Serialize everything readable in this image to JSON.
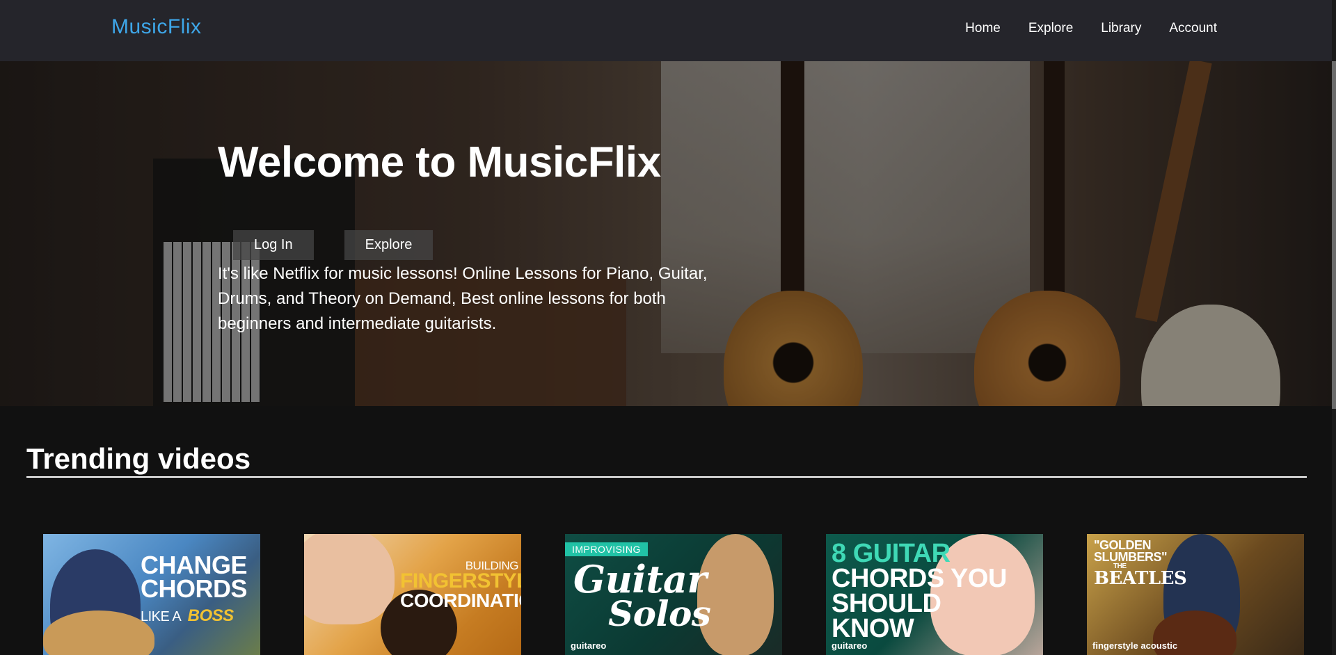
{
  "brand": "MusicFlix",
  "nav": {
    "items": [
      "Home",
      "Explore",
      "Library",
      "Account"
    ]
  },
  "hero": {
    "title": "Welcome to MusicFlix",
    "buttons": {
      "login": "Log In",
      "explore": "Explore"
    },
    "description": "It's like Netflix for music lessons! Online Lessons for Piano, Guitar, Drums, and Theory on Demand, Best online lessons for both beginners and intermediate guitarists."
  },
  "trending": {
    "title": "Trending videos",
    "videos": [
      {
        "line1": "CHANGE",
        "line2": "CHORDS",
        "line3": "LIKE A",
        "line4": "BOSS"
      },
      {
        "line1": "BUILDING",
        "line2": "FINGERSTYLE",
        "line3": "COORDINATION"
      },
      {
        "tag": "IMPROVISING",
        "line1": "Guitar",
        "line2": "Solos",
        "footer": "guitareo"
      },
      {
        "line1": "8 GUITAR",
        "line2": "CHORDS YOU",
        "line3": "SHOULD",
        "line4": "KNOW",
        "footer": "guitareo"
      },
      {
        "line1": "\"GOLDEN",
        "line2": "SLUMBERS\"",
        "line3": "THE",
        "line4": "BEATLES",
        "footer": "fingerstyle acoustic"
      }
    ]
  },
  "colors": {
    "navbar": "#25252b",
    "brand": "#3ea6e8",
    "background": "#111111",
    "accent_tag": "#21c2a6"
  }
}
